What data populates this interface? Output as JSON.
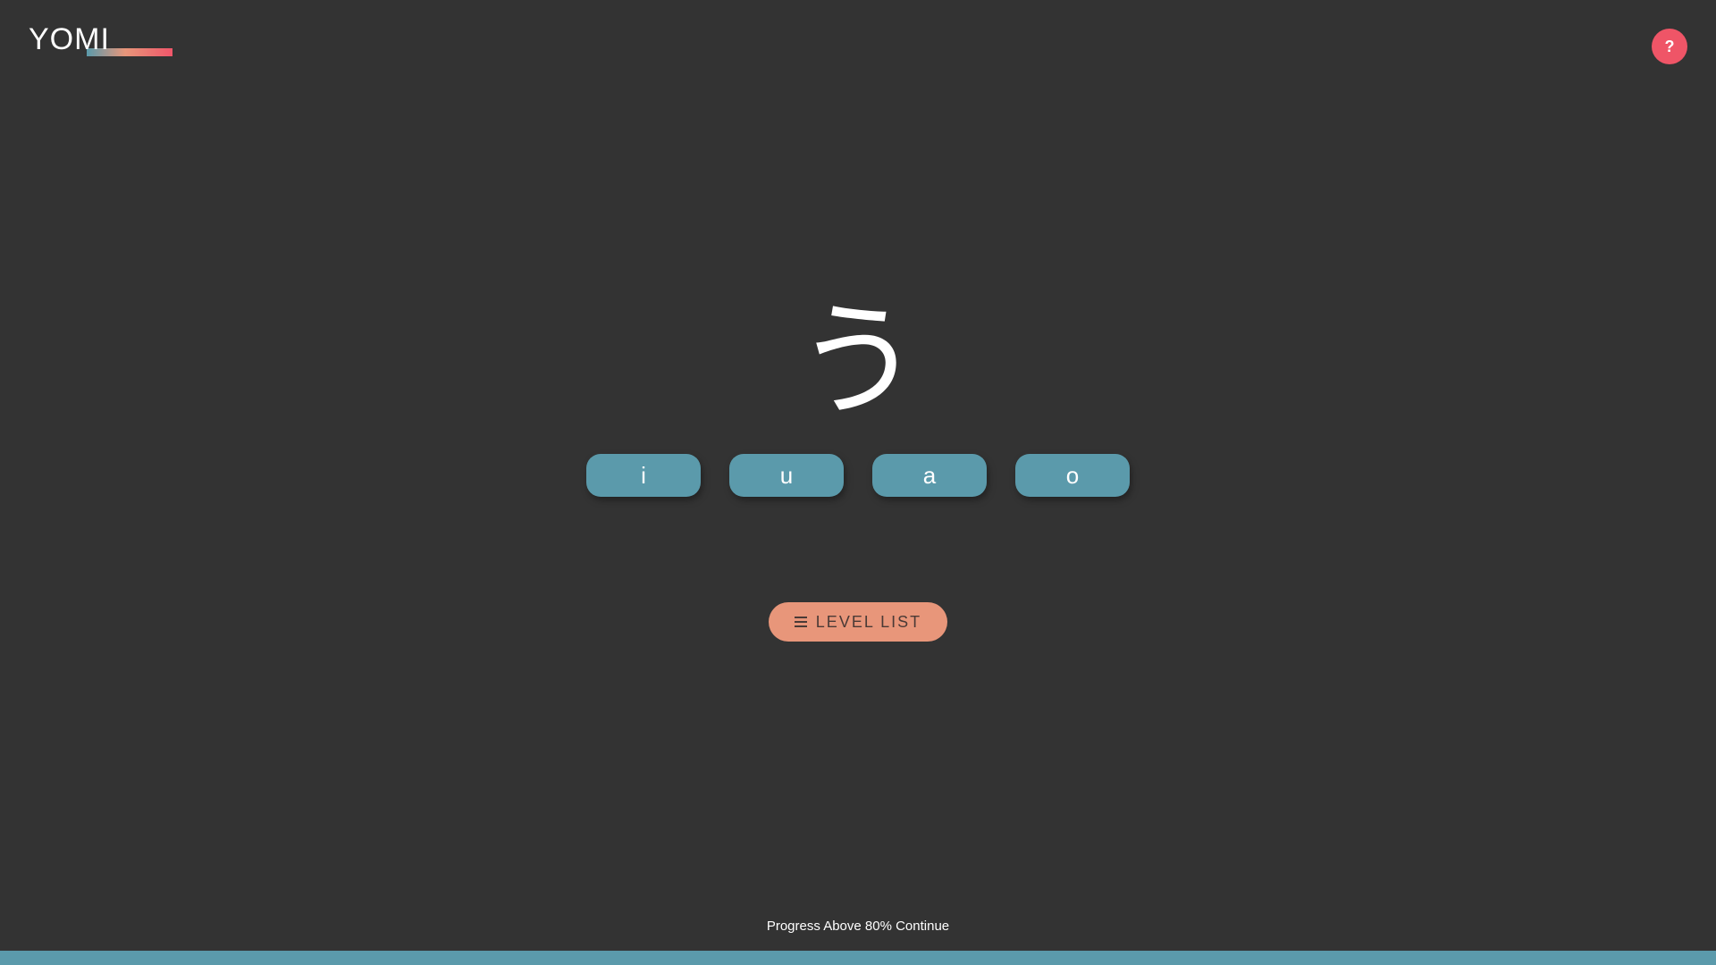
{
  "header": {
    "logo_text": "YOMI",
    "help_label": "?"
  },
  "quiz": {
    "character": "う",
    "options": [
      "i",
      "u",
      "a",
      "o"
    ]
  },
  "level_list": {
    "label": "LEVEL LIST",
    "icon": "menu-icon"
  },
  "footer": {
    "text": "Progress Above 80% Continue",
    "progress_fraction": 1.0
  },
  "colors": {
    "background": "#333333",
    "accent_blue": "#5b9aab",
    "accent_peach": "#e8967a",
    "accent_red": "#ef5567"
  }
}
